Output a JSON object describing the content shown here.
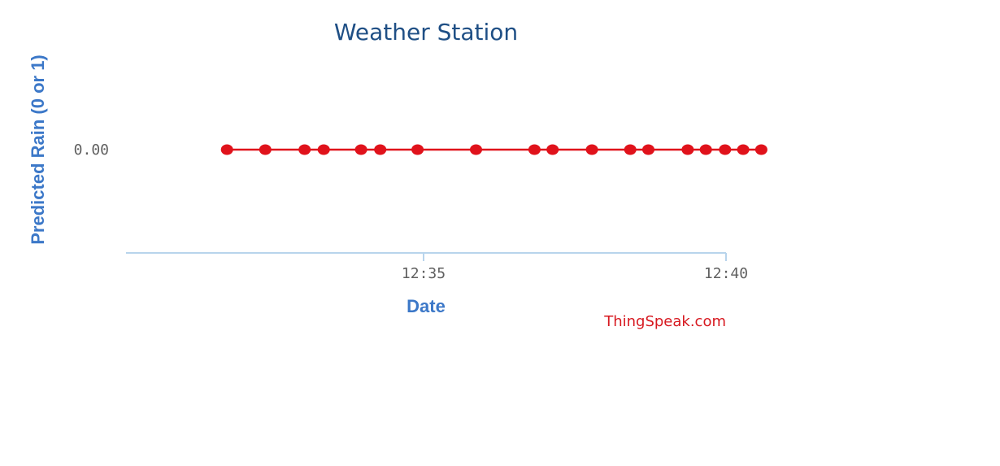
{
  "chart_data": {
    "type": "line",
    "title": "Weather Station",
    "xlabel": "Date",
    "ylabel": "Predicted Rain (0 or 1)",
    "x_ticks": [
      "12:35",
      "12:40"
    ],
    "y_ticks": [
      "0.00"
    ],
    "series": [
      {
        "x": [
          "12:31:45",
          "12:32:23",
          "12:33:02",
          "12:33:21",
          "12:33:58",
          "12:34:17",
          "12:34:54",
          "12:35:52",
          "12:36:50",
          "12:37:08",
          "12:37:47",
          "12:38:25",
          "12:38:43",
          "12:39:22",
          "12:39:40",
          "12:39:59",
          "12:40:17",
          "12:40:35"
        ],
        "y": [
          0,
          0,
          0,
          0,
          0,
          0,
          0,
          0,
          0,
          0,
          0,
          0,
          0,
          0,
          0,
          0,
          0,
          0
        ]
      }
    ],
    "grid": false,
    "legend": "none"
  },
  "credit": "ThingSpeak.com",
  "colors": {
    "series": "#e0121b",
    "title": "#1f4f85",
    "axis_title": "#3c78c8",
    "axis_line": "#b8d4ec",
    "credit": "#d71920"
  }
}
